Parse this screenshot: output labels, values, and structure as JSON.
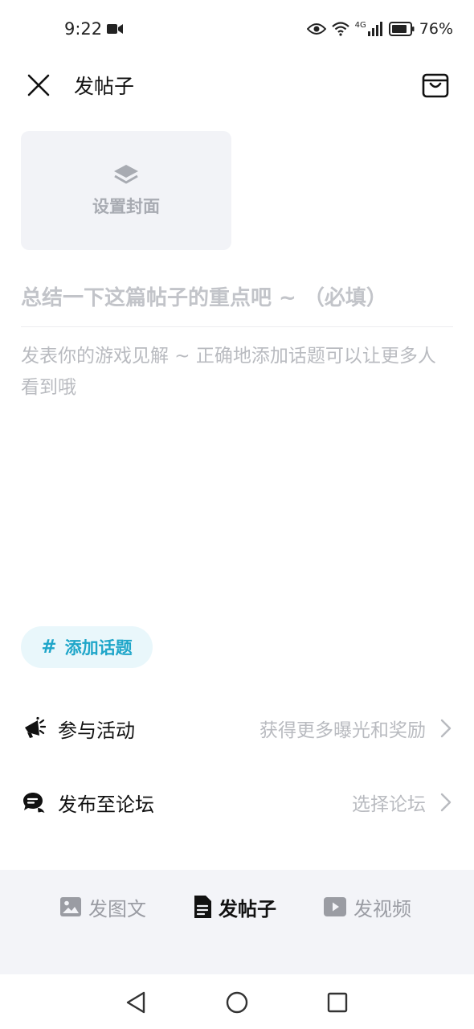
{
  "status_bar": {
    "time": "9:22",
    "network": "4G",
    "battery": "76%"
  },
  "header": {
    "title": "发帖子"
  },
  "cover": {
    "label": "设置封面"
  },
  "editor": {
    "title_placeholder": "总结一下这篇帖子的重点吧 ~ （必填）",
    "body_placeholder": "发表你的游戏见解 ~ 正确地添加话题可以让更多人看到哦"
  },
  "topic": {
    "hash": "#",
    "label": "添加话题"
  },
  "rows": [
    {
      "label": "参与活动",
      "hint": "获得更多曝光和奖励"
    },
    {
      "label": "发布至论坛",
      "hint": "选择论坛"
    }
  ],
  "tabs": [
    {
      "label": "发图文",
      "active": false
    },
    {
      "label": "发帖子",
      "active": true
    },
    {
      "label": "发视频",
      "active": false
    }
  ],
  "colors": {
    "accent": "#1fa6c9",
    "placeholder": "#b9bbc0",
    "panel": "#f3f4f8"
  }
}
